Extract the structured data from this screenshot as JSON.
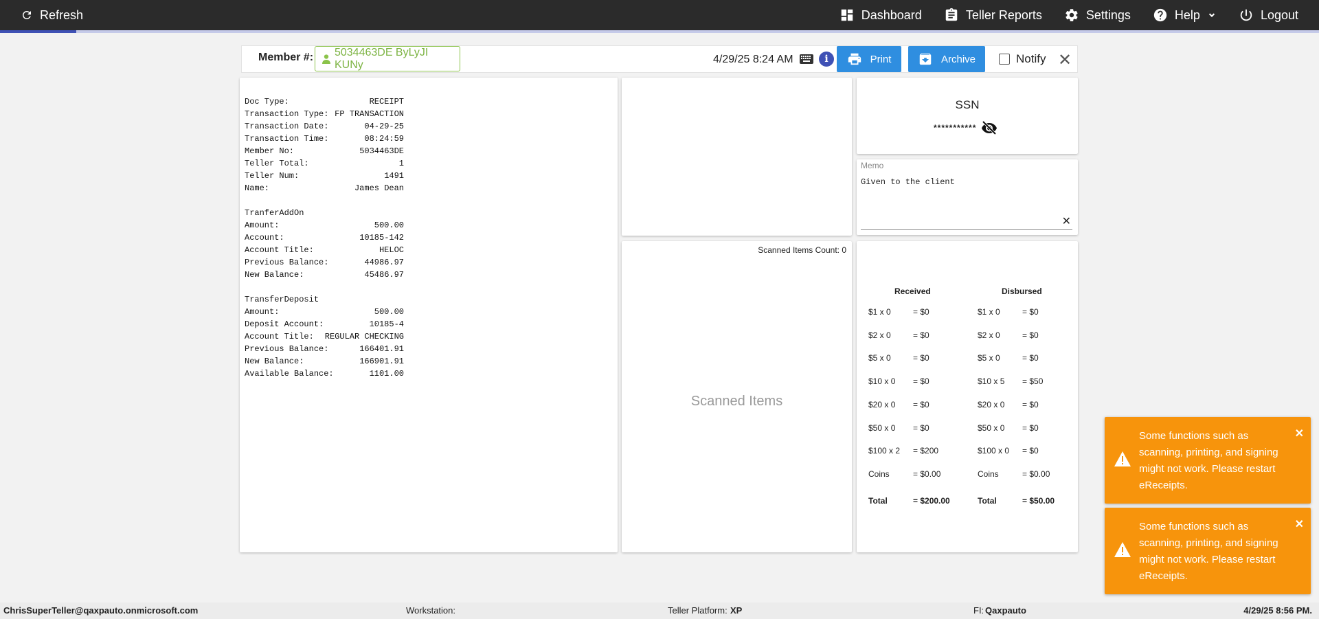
{
  "topbar": {
    "refresh": "Refresh",
    "dashboard": "Dashboard",
    "teller_reports": "Teller Reports",
    "settings": "Settings",
    "help": "Help",
    "logout": "Logout",
    "progress": 0.058
  },
  "member_bar": {
    "label": "Member #:",
    "member_value": "5034463DE ByLyJI KUNy",
    "datetime": "4/29/25 8:24 AM",
    "print": "Print",
    "archive": "Archive",
    "notify": "Notify"
  },
  "receipt": {
    "lines": [
      [
        "Doc Type:",
        "RECEIPT"
      ],
      [
        "Transaction Type:",
        "FP TRANSACTION"
      ],
      [
        "Transaction Date:",
        "04-29-25"
      ],
      [
        "Transaction Time:",
        "08:24:59"
      ],
      [
        "Member No:",
        "5034463DE"
      ],
      [
        "Teller Total:",
        "1"
      ],
      [
        "Teller Num:",
        "1491"
      ],
      [
        "Name:",
        "James Dean"
      ],
      [
        "",
        ""
      ],
      [
        "TranferAddOn",
        ""
      ],
      [
        "Amount:",
        "500.00"
      ],
      [
        "Account:",
        "10185-142"
      ],
      [
        "Account Title:",
        "HELOC"
      ],
      [
        "Previous Balance:",
        "44986.97"
      ],
      [
        "New Balance:",
        "45486.97"
      ],
      [
        "",
        ""
      ],
      [
        "TransferDeposit",
        ""
      ],
      [
        "Amount:",
        "500.00"
      ],
      [
        "Deposit Account:",
        "10185-4"
      ],
      [
        "Account Title:",
        "REGULAR CHECKING"
      ],
      [
        "Previous Balance:",
        "166401.91"
      ],
      [
        "New Balance:",
        "166901.91"
      ],
      [
        "Available Balance:",
        "1101.00"
      ]
    ]
  },
  "scanned": {
    "count_label": "Scanned Items Count: 0",
    "placeholder": "Scanned Items"
  },
  "ssn": {
    "title": "SSN",
    "masked": "***********"
  },
  "memo": {
    "label": "Memo",
    "text": "Given to the client"
  },
  "cash": {
    "received_label": "Received",
    "disbursed_label": "Disbursed",
    "received": [
      [
        "$1 x 0",
        "= $0"
      ],
      [
        "$2 x 0",
        "= $0"
      ],
      [
        "$5 x 0",
        "= $0"
      ],
      [
        "$10 x 0",
        "= $0"
      ],
      [
        "$20 x 0",
        "= $0"
      ],
      [
        "$50 x 0",
        "= $0"
      ],
      [
        "$100 x 2",
        "= $200"
      ],
      [
        "Coins",
        "= $0.00"
      ],
      [
        "Total",
        "= $200.00"
      ]
    ],
    "disbursed": [
      [
        "$1 x 0",
        "= $0"
      ],
      [
        "$2 x 0",
        "= $0"
      ],
      [
        "$5 x 0",
        "= $0"
      ],
      [
        "$10 x 5",
        "= $50"
      ],
      [
        "$20 x 0",
        "= $0"
      ],
      [
        "$50 x 0",
        "= $0"
      ],
      [
        "$100 x 0",
        "= $0"
      ],
      [
        "Coins",
        "= $0.00"
      ],
      [
        "Total",
        "= $50.00"
      ]
    ]
  },
  "toasts": [
    {
      "text": "Some functions such as scanning, printing, and signing might not work. Please restart eReceipts."
    },
    {
      "text": "Some functions such as scanning, printing, and signing might not work. Please restart eReceipts."
    }
  ],
  "footer": {
    "user": "ChrisSuperTeller@qaxpauto.onmicrosoft.com",
    "workstation_label": "Workstation:",
    "platform_label": "Teller Platform:",
    "platform_value": "XP",
    "fi_label": "FI:",
    "fi_value": "Qaxpauto",
    "datetime": "4/29/25 8:56 PM."
  },
  "colors": {
    "nav_bg": "#2b2b2b",
    "accent_blue": "#2f8ee0",
    "member_green": "#8bc34a",
    "toast_orange": "#f7940c",
    "progress": "#3f51b5"
  }
}
